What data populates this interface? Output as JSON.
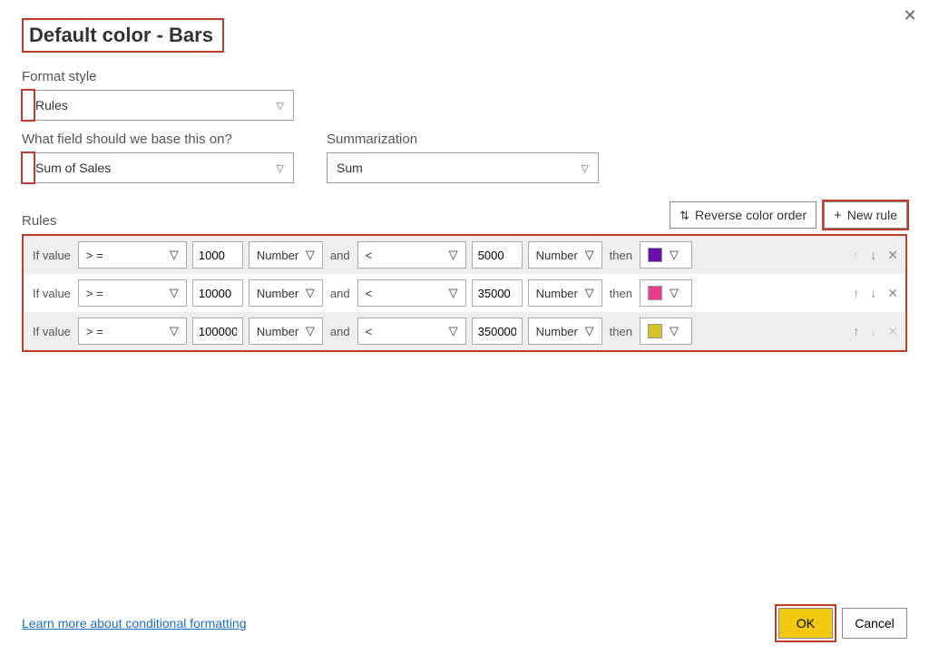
{
  "title": "Default color - Bars",
  "labels": {
    "format_style": "Format style",
    "field_base": "What field should we base this on?",
    "summarization": "Summarization",
    "rules": "Rules",
    "if_value": "If value",
    "and": "and",
    "then": "then"
  },
  "dropdowns": {
    "format_style_value": "Rules",
    "field_value": "Sum of Sales",
    "summarization_value": "Sum"
  },
  "buttons": {
    "reverse": "Reverse color order",
    "new_rule": "New rule",
    "ok": "OK",
    "cancel": "Cancel"
  },
  "link": "Learn more about conditional formatting",
  "rules_list": [
    {
      "op1": "> =",
      "val1": "1000",
      "type1": "Number",
      "op2": "<",
      "val2": "5000",
      "type2": "Number",
      "color": "#6a0dad",
      "up_disabled": true,
      "down_disabled": false,
      "del_disabled": false,
      "alt": true
    },
    {
      "op1": "> =",
      "val1": "10000",
      "type1": "Number",
      "op2": "<",
      "val2": "35000",
      "type2": "Number",
      "color": "#e83e8c",
      "up_disabled": false,
      "down_disabled": false,
      "del_disabled": false,
      "alt": false
    },
    {
      "op1": "> =",
      "val1": "100000",
      "type1": "Number",
      "op2": "<",
      "val2": "350000",
      "type2": "Number",
      "color": "#d4c22a",
      "up_disabled": false,
      "down_disabled": true,
      "del_disabled": true,
      "alt": true
    }
  ]
}
